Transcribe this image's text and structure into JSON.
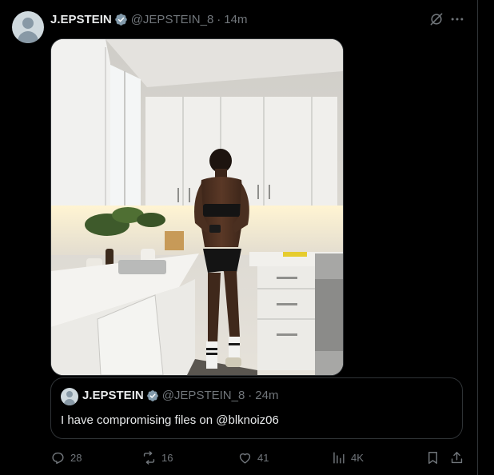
{
  "post": {
    "author_name": "J.EPSTEIN",
    "handle": "@JEPSTEIN_8",
    "separator": "·",
    "time": "14m"
  },
  "quote": {
    "author_name": "J.EPSTEIN",
    "handle": "@JEPSTEIN_8",
    "separator": "·",
    "time": "24m",
    "text": "I have compromising files on @blknoiz06"
  },
  "actions": {
    "replies": "28",
    "reposts": "16",
    "likes": "41",
    "views": "4K"
  },
  "icons": {
    "verified": "verified-badge-icon",
    "grok": "grok-icon",
    "more": "more-icon",
    "reply": "reply-icon",
    "repost": "repost-icon",
    "like": "like-icon",
    "views": "views-icon",
    "bookmark": "bookmark-icon",
    "share": "share-icon"
  },
  "colors": {
    "background": "#000000",
    "text": "#e7e9ea",
    "muted": "#71767b",
    "border": "#2f3336",
    "verified": "#829aab"
  }
}
